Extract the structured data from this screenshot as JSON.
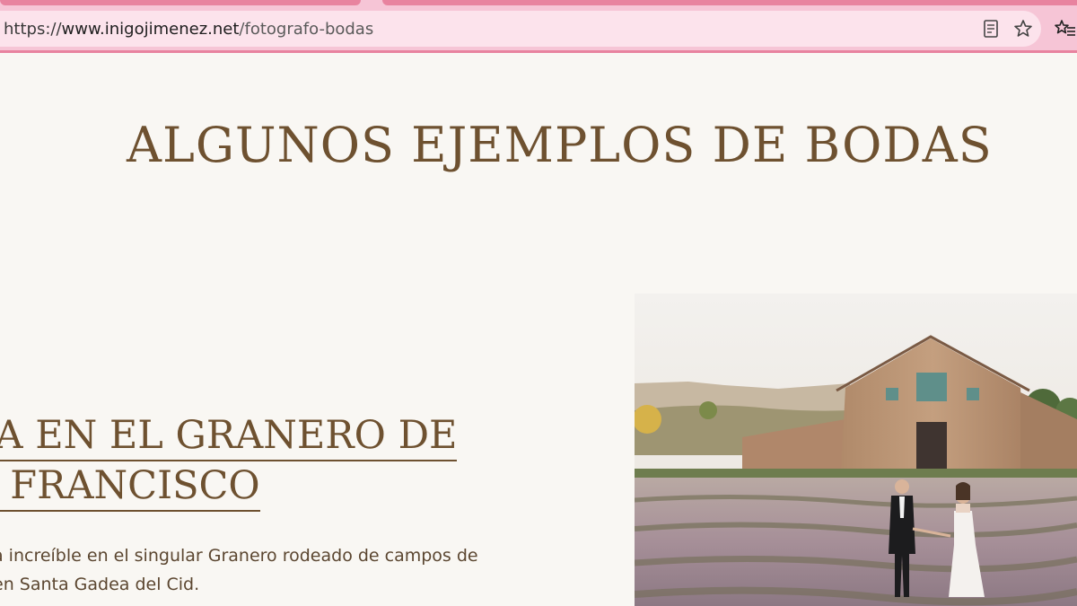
{
  "browser": {
    "url_scheme": "https://",
    "url_host": "www.inigojimenez.net",
    "url_path": "/fotografo-bodas",
    "icons": [
      "reader-mode-icon",
      "bookmark-star-icon",
      "favorites-icon"
    ]
  },
  "page": {
    "title": "ALGUNOS EJEMPLOS DE BODAS",
    "headline_line1": "DA EN EL GRANERO DE",
    "headline_line2": "N FRANCISCO",
    "desc_line1": "a increíble en el singular Granero rodeado de campos de",
    "desc_line2": "en Santa Gadea del Cid."
  },
  "colors": {
    "background": "#f9f7f3",
    "accent_brown": "#6e5130",
    "chrome_pink": "#f6c5d6",
    "chrome_tab": "#e8839f"
  }
}
